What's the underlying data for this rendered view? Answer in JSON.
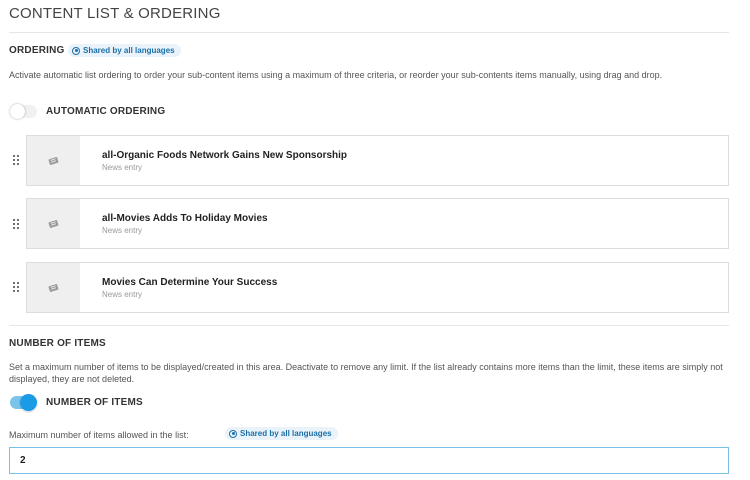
{
  "page": {
    "title": "CONTENT LIST & ORDERING"
  },
  "ordering": {
    "label": "ORDERING",
    "badge": "Shared by all languages",
    "description": "Activate automatic list ordering to order your sub-content items using a maximum of three criteria, or reorder your sub-contents items manually, using drag and drop.",
    "toggle_label": "AUTOMATIC ORDERING",
    "toggle_on": false
  },
  "items": [
    {
      "title": "all-Organic Foods Network Gains New Sponsorship",
      "type": "News entry",
      "icon": "news-icon"
    },
    {
      "title": "all-Movies Adds To Holiday Movies",
      "type": "News entry",
      "icon": "news-icon"
    },
    {
      "title": "Movies Can Determine Your Success",
      "type": "News entry",
      "icon": "news-icon"
    }
  ],
  "number_of_items": {
    "label": "NUMBER OF ITEMS",
    "description": "Set a maximum number of items to be displayed/created in this area. Deactivate to remove any limit. If the list already contains more items than the limit, these items are simply not displayed, they are not deleted.",
    "toggle_label": "NUMBER OF ITEMS",
    "toggle_on": true,
    "field_label": "Maximum number of items allowed in the list:",
    "badge": "Shared by all languages",
    "value": "2"
  },
  "colors": {
    "accent": "#1a9be6",
    "badge_text": "#1b6fa8",
    "badge_bg": "#eaf3fa"
  }
}
